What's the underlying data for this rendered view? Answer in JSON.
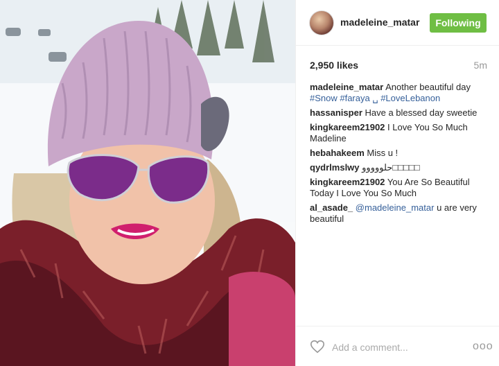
{
  "post": {
    "username": "madeleine_matar",
    "follow_label": "Following",
    "likes_text": "2,950 likes",
    "time_ago": "5m",
    "caption": {
      "user": "madeleine_matar",
      "text": "Another beautiful day",
      "tags": "#Snow #faraya ␣ #LoveLebanon"
    },
    "comments": [
      {
        "user": "hassanisper",
        "text": "Have a blessed day sweetie"
      },
      {
        "user": "kingkareem21902",
        "text": "I Love You So Much Madeline"
      },
      {
        "user": "hebahakeem",
        "text": "Miss u !"
      },
      {
        "user": "qydrlmslwy",
        "text": "حلووووو□□□□□"
      },
      {
        "user": "kingkareem21902",
        "text": "You Are So Beautiful Today I Love You So Much"
      },
      {
        "user": "al_asade_",
        "mention": "@madeleine_matar",
        "text": "u are very beautiful"
      }
    ],
    "add_comment_placeholder": "Add a comment...",
    "more_label": "ooo"
  },
  "colors": {
    "follow_button": "#6fbe44",
    "link": "#36609a",
    "muted": "#999999"
  },
  "icons": [
    "heart-icon",
    "more-options-icon"
  ]
}
